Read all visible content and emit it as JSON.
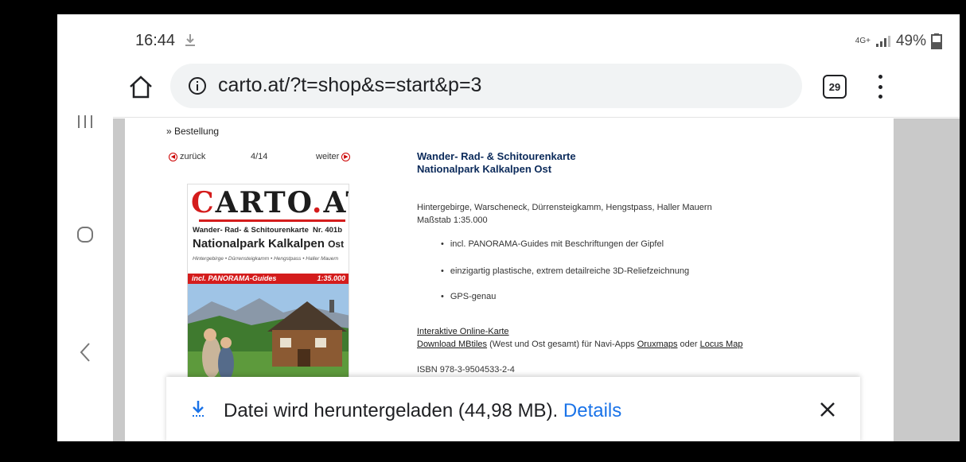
{
  "status_bar": {
    "time": "16:44",
    "network": "4G+",
    "battery": "49%"
  },
  "browser": {
    "url": "carto.at/?t=shop&s=start&p=3",
    "tab_count": "29"
  },
  "page": {
    "breadcrumb": "» Bestellung",
    "pager": {
      "prev_label": "zurück",
      "count": "4/14",
      "next_label": "weiter"
    },
    "cover": {
      "brand_c": "C",
      "brand_rest": "ARTO",
      "brand_dot": ".",
      "brand_at": "AT",
      "subtitle": "Wander- Rad- & Schitourenkarte",
      "number": "Nr. 401b",
      "title": "Nationalpark Kalkalpen",
      "title_suffix": "Ost",
      "places": "Hintergebirge • Dürrensteigkamm • Hengstpass • Haller Mauern",
      "band_left": "incl. PANORAMA-Guides",
      "band_right": "1:35.000"
    },
    "product": {
      "title_line1": "Wander- Rad- & Schitourenkarte",
      "title_line2": "Nationalpark Kalkalpen Ost",
      "places": "Hintergebirge, Warscheneck, Dürrensteigkamm, Hengstpass, Haller Mauern",
      "scale": "Maßstab 1:35.000",
      "features": [
        "incl. PANORAMA-Guides mit Beschriftungen der Gipfel",
        "einzigartig plastische, extrem detailreiche 3D-Reliefzeichnung",
        "GPS-genau"
      ],
      "link_online": "Interaktive Online-Karte",
      "link_mbtiles": "Download MBtiles",
      "mbtiles_text": " (West und Ost gesamt) für Navi-Apps ",
      "link_oruxmaps": "Oruxmaps",
      "or_text": " oder ",
      "link_locus": "Locus Map",
      "isbn": "ISBN 978-3-9504533-2-4"
    }
  },
  "download": {
    "message": "Datei wird heruntergeladen (44,98 MB). ",
    "details_label": "Details"
  }
}
